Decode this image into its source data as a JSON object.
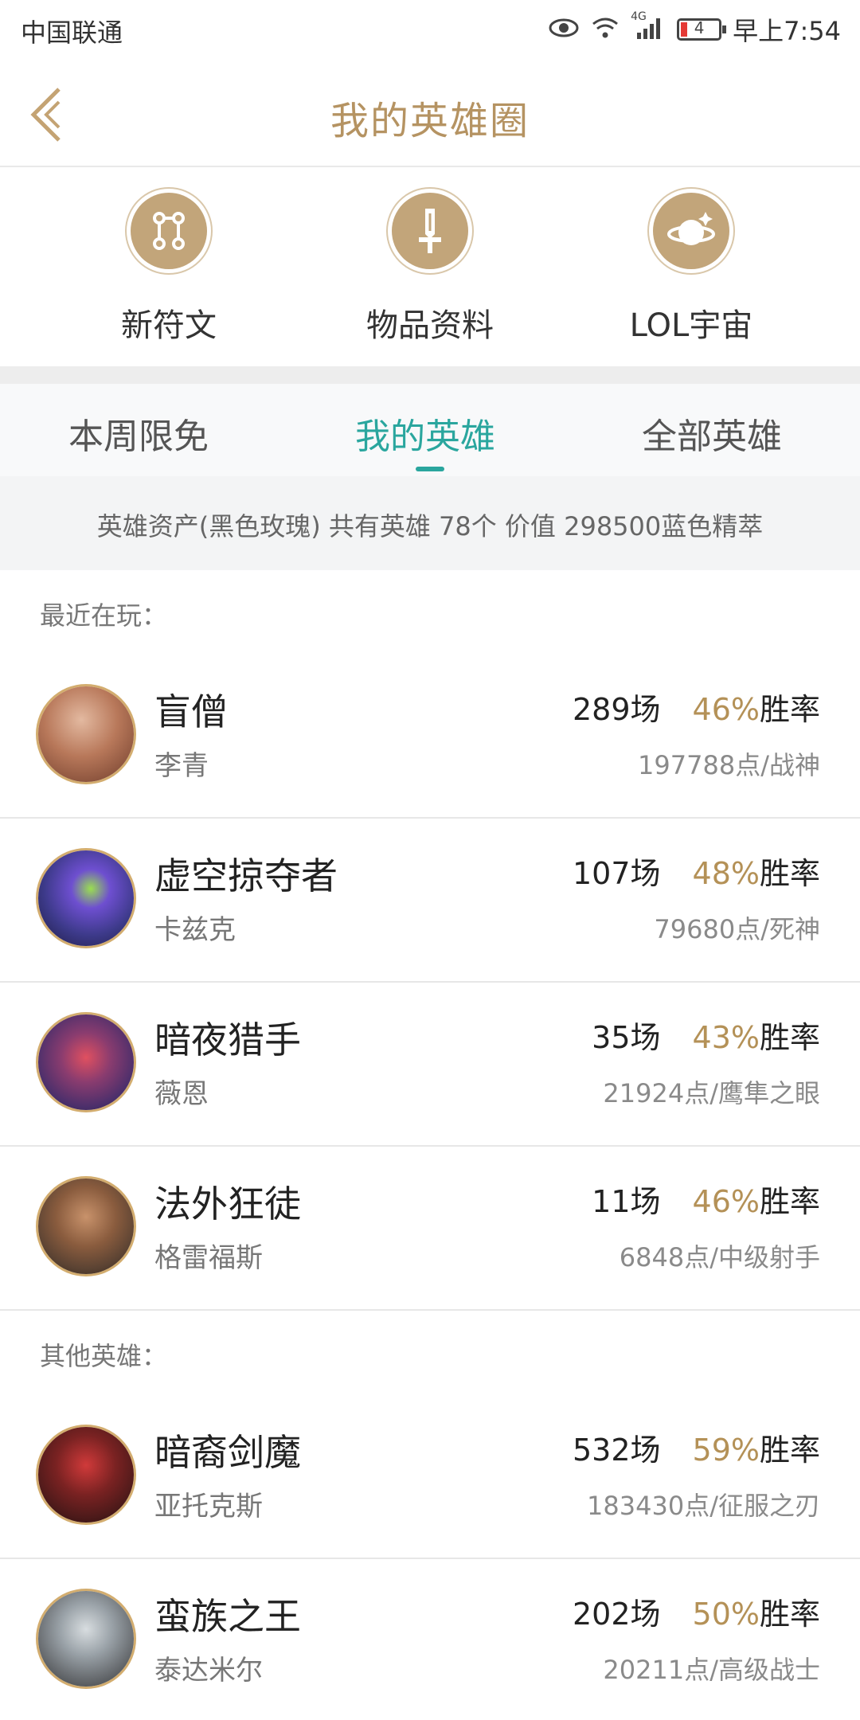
{
  "status_bar": {
    "carrier": "中国联通",
    "network": "4G",
    "battery": "4",
    "time": "早上7:54"
  },
  "header": {
    "title": "我的英雄圈",
    "back_icon": "chevron-left-icon"
  },
  "features": [
    {
      "label": "新符文",
      "icon": "rune-icon"
    },
    {
      "label": "物品资料",
      "icon": "sword-icon"
    },
    {
      "label": "LOL宇宙",
      "icon": "planet-icon"
    }
  ],
  "tabs": [
    {
      "label": "本周限免",
      "active": false
    },
    {
      "label": "我的英雄",
      "active": true
    },
    {
      "label": "全部英雄",
      "active": false
    }
  ],
  "assets_summary": "英雄资产(黑色玫瑰)  共有英雄 78个  价值 298500蓝色精萃",
  "recent": {
    "title": "最近在玩：",
    "heroes": [
      {
        "name": "盲僧",
        "sub": "李青",
        "games": "289场",
        "rate": "46%",
        "rate_suffix": "胜率",
        "points": "197788点/战神",
        "avatar_color": "#b8785a"
      },
      {
        "name": "虚空掠夺者",
        "sub": "卡兹克",
        "games": "107场",
        "rate": "48%",
        "rate_suffix": "胜率",
        "points": "79680点/死神",
        "avatar_color": "#3d3a8a"
      },
      {
        "name": "暗夜猎手",
        "sub": "薇恩",
        "games": "35场",
        "rate": "43%",
        "rate_suffix": "胜率",
        "points": "21924点/鹰隼之眼",
        "avatar_color": "#4b2f6b"
      },
      {
        "name": "法外狂徒",
        "sub": "格雷福斯",
        "games": "11场",
        "rate": "46%",
        "rate_suffix": "胜率",
        "points": "6848点/中级射手",
        "avatar_color": "#5b4333"
      }
    ]
  },
  "others": {
    "title": "其他英雄：",
    "heroes": [
      {
        "name": "暗裔剑魔",
        "sub": "亚托克斯",
        "games": "532场",
        "rate": "59%",
        "rate_suffix": "胜率",
        "points": "183430点/征服之刃",
        "avatar_color": "#4d1a1a"
      },
      {
        "name": "蛮族之王",
        "sub": "泰达米尔",
        "games": "202场",
        "rate": "50%",
        "rate_suffix": "胜率",
        "points": "20211点/高级战士",
        "avatar_color": "#6a6e72"
      }
    ]
  },
  "colors": {
    "accent_gold": "#b59362",
    "accent_teal": "#2aa69e",
    "win_rate": "#b49157"
  }
}
